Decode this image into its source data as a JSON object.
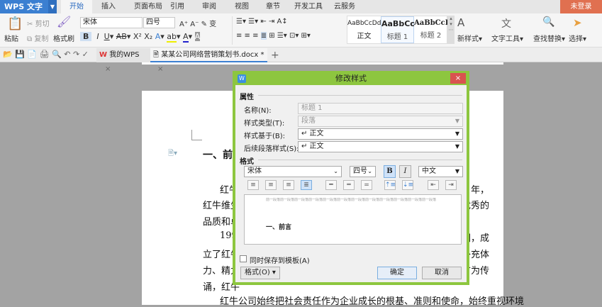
{
  "app": {
    "name": "WPS 文字",
    "login": "未登录"
  },
  "menu_tabs": [
    "开始",
    "插入",
    "页面布局",
    "引用",
    "审阅",
    "视图",
    "章节",
    "开发工具",
    "云服务"
  ],
  "ribbon": {
    "paste": "粘贴",
    "cut": "剪切",
    "copy": "复制",
    "format_painter": "格式刷",
    "font": "宋体",
    "size": "四号",
    "styles": [
      {
        "sample": "AaBbCcDd",
        "name": "正文"
      },
      {
        "sample": "AaBbCc",
        "name": "标题 1"
      },
      {
        "sample": "AaBbCcD",
        "name": "标题 2"
      }
    ],
    "new_style": "新样式",
    "text_tools": "文字工具",
    "find_replace": "查找替换",
    "select": "选择"
  },
  "doc_tabs": [
    {
      "label": "我的WPS"
    },
    {
      "label": "某某公司网络营销策划书.docx *"
    }
  ],
  "document": {
    "heading": "一、前",
    "lines_left": [
      "红牛",
      "红牛维生",
      "品质和卓",
      "199",
      "立了红牛",
      "力、精力",
      "诵，红牛"
    ],
    "lines_right": [
      "6 年，",
      "优秀的",
      "",
      "国，成",
      "补充体",
      "广为传",
      ""
    ],
    "last_line": "红牛公司始终把社会责任作为企业成长的根基、准则和使命，始终重视环境"
  },
  "dialog": {
    "title": "修改样式",
    "section_props": "属性",
    "name_label": "名称(N):",
    "name_value": "标题 1",
    "type_label": "样式类型(T):",
    "type_value": "段落",
    "based_label": "样式基于(B):",
    "based_value": "↵ 正文",
    "next_label": "后续段落样式(S):",
    "next_value": "↵ 正文",
    "section_format": "格式",
    "font": "宋体",
    "size": "四号",
    "bold": "B",
    "italic": "I",
    "script": "中文",
    "preview_sample": "前一段落前一段落前一段落前一段落前一段落前一段落前一段落前一段落前一段落前一段落前一段落前一段落",
    "preview_heading": "一、前言",
    "save_template": "同时保存到模板(A)",
    "format_btn": "格式(O)",
    "ok": "确定",
    "cancel": "取消"
  },
  "colors": {
    "accent": "#3b7fd1",
    "dialog_border": "#8dc63f",
    "login": "#e07050",
    "close": "#d9534f"
  }
}
